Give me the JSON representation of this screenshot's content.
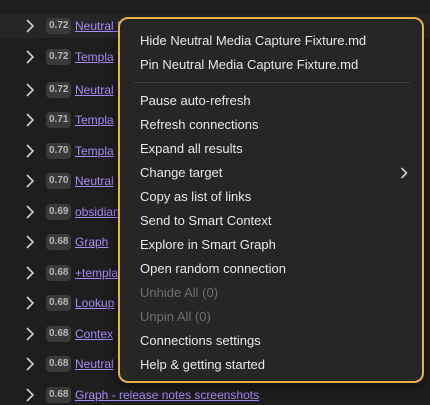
{
  "connections": [
    {
      "score": "0.72",
      "title": "Neutral Media Capture Fixture.md"
    },
    {
      "score": "0.72",
      "title": "Templa"
    },
    {
      "score": "0.72",
      "title": "Neutral"
    },
    {
      "score": "0.71",
      "title": "Templa"
    },
    {
      "score": "0.70",
      "title": "Templa"
    },
    {
      "score": "0.70",
      "title": "Neutral"
    },
    {
      "score": "0.69",
      "title": "obsidian"
    },
    {
      "score": "0.68",
      "title": "Graph"
    },
    {
      "score": "0.68",
      "title": "+templa"
    },
    {
      "score": "0.68",
      "title": "Lookup"
    },
    {
      "score": "0.68",
      "title": "Contex"
    },
    {
      "score": "0.68",
      "title": "Neutral"
    },
    {
      "score": "0.68",
      "title": "Graph - release notes screenshots"
    }
  ],
  "menu": {
    "items": [
      {
        "label": "Hide Neutral Media Capture Fixture.md",
        "disabled": false
      },
      {
        "label": "Pin Neutral Media Capture Fixture.md",
        "disabled": false
      },
      {
        "label": "Pause auto-refresh",
        "disabled": false
      },
      {
        "label": "Refresh connections",
        "disabled": false
      },
      {
        "label": "Expand all results",
        "disabled": false
      },
      {
        "label": "Change target",
        "disabled": false,
        "submenu": true
      },
      {
        "label": "Copy as list of links",
        "disabled": false
      },
      {
        "label": "Send to Smart Context",
        "disabled": false
      },
      {
        "label": "Explore in Smart Graph",
        "disabled": false
      },
      {
        "label": "Open random connection",
        "disabled": false
      },
      {
        "label": "Unhide All (0)",
        "disabled": true
      },
      {
        "label": "Unpin All (0)",
        "disabled": true
      },
      {
        "label": "Connections settings",
        "disabled": false
      },
      {
        "label": "Help & getting started",
        "disabled": false
      }
    ]
  },
  "colors": {
    "accent_border": "#e5b14a",
    "link": "#a88bfa"
  }
}
